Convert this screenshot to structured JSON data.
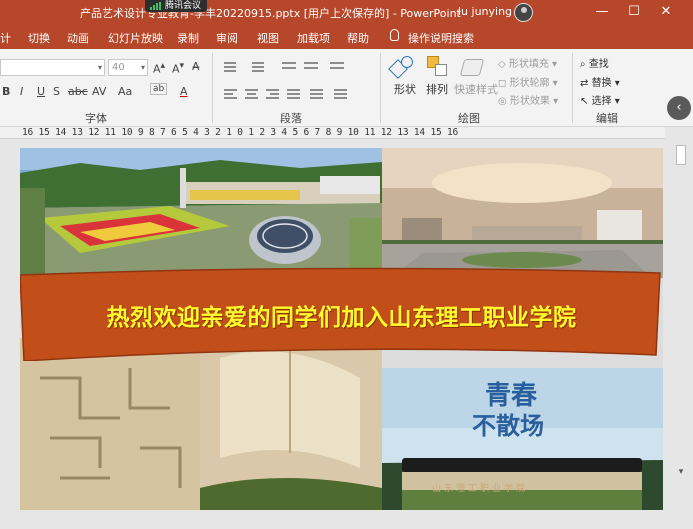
{
  "window": {
    "doc_title": "产品艺术设计专业教育-李丰20220915.pptx [用户上次保存的] - PowerPoint",
    "meeting_label": "腾讯会议",
    "user_name": "lu junying",
    "minimize": "—",
    "maximize": "☐",
    "close": "✕"
  },
  "tabs": [
    "计",
    "切换",
    "动画",
    "幻灯片放映",
    "录制",
    "审阅",
    "视图",
    "加载项",
    "帮助"
  ],
  "tell_me": "操作说明搜索",
  "ribbon": {
    "font_size": "40",
    "font_buttons": [
      "B",
      "I",
      "U",
      "S",
      "abc",
      "AV",
      "Aa",
      "A"
    ],
    "groups": {
      "font": "字体",
      "paragraph": "段落",
      "drawing": "绘图",
      "editing": "编辑"
    },
    "shape_button": "形状",
    "arrange_button": "排列",
    "quick_styles_button": "快速样式",
    "shape_fill": "形状填充",
    "shape_outline": "形状轮廓",
    "shape_effects": "形状效果",
    "find": "查找",
    "replace": "替换",
    "select": "选择"
  },
  "ruler": "16 15 14 13 12 11 10  9  8  7  6  5  4  3  2  1  0  1  2  3  4  5  6  7  8  9 10 11 12 13 14 15 16",
  "slide": {
    "banner_text": "热烈欢迎亲爱的同学们加入山东理工职业学院",
    "poem_line1": "青春",
    "poem_line2": "不散场",
    "arch_text": "山东理工职业学院"
  },
  "colors": {
    "accent": "#b7472a",
    "banner": "#c24e1a",
    "banner_text": "#fffb2d"
  }
}
